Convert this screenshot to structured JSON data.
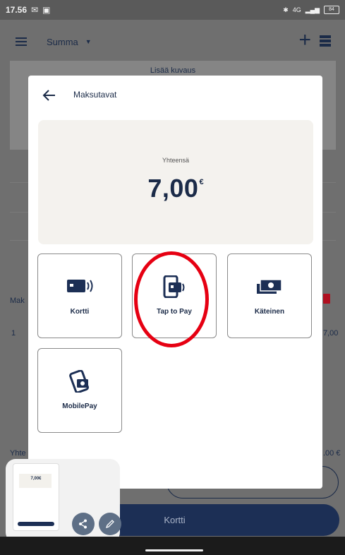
{
  "status_bar": {
    "time": "17.56",
    "network": "4G",
    "battery": "84"
  },
  "app_bar": {
    "title": "Summa"
  },
  "background": {
    "description_link": "Lisää kuvaus",
    "payments_row_label": "Mak",
    "row_qty": "1",
    "row_amount": "7,00",
    "total_label": "Yhte",
    "total_amount": ".00 €",
    "primary_button": "Kortti"
  },
  "dialog": {
    "title": "Maksutavat",
    "total_label": "Yhteensä",
    "total_amount": "7,00",
    "currency": "€",
    "methods": [
      {
        "label": "Kortti",
        "icon": "card-contactless-icon"
      },
      {
        "label": "Tap to Pay",
        "icon": "phone-tap-icon"
      },
      {
        "label": "Käteinen",
        "icon": "cash-icon"
      },
      {
        "label": "MobilePay",
        "icon": "mobilepay-icon"
      }
    ]
  },
  "screenshot_preview": {
    "thumb_amount": "7,00€",
    "share_icon": "share-icon",
    "edit_icon": "pencil-icon"
  },
  "colors": {
    "brand": "#1c2f55",
    "highlight_circle": "#e60012",
    "delete": "#b01020"
  }
}
